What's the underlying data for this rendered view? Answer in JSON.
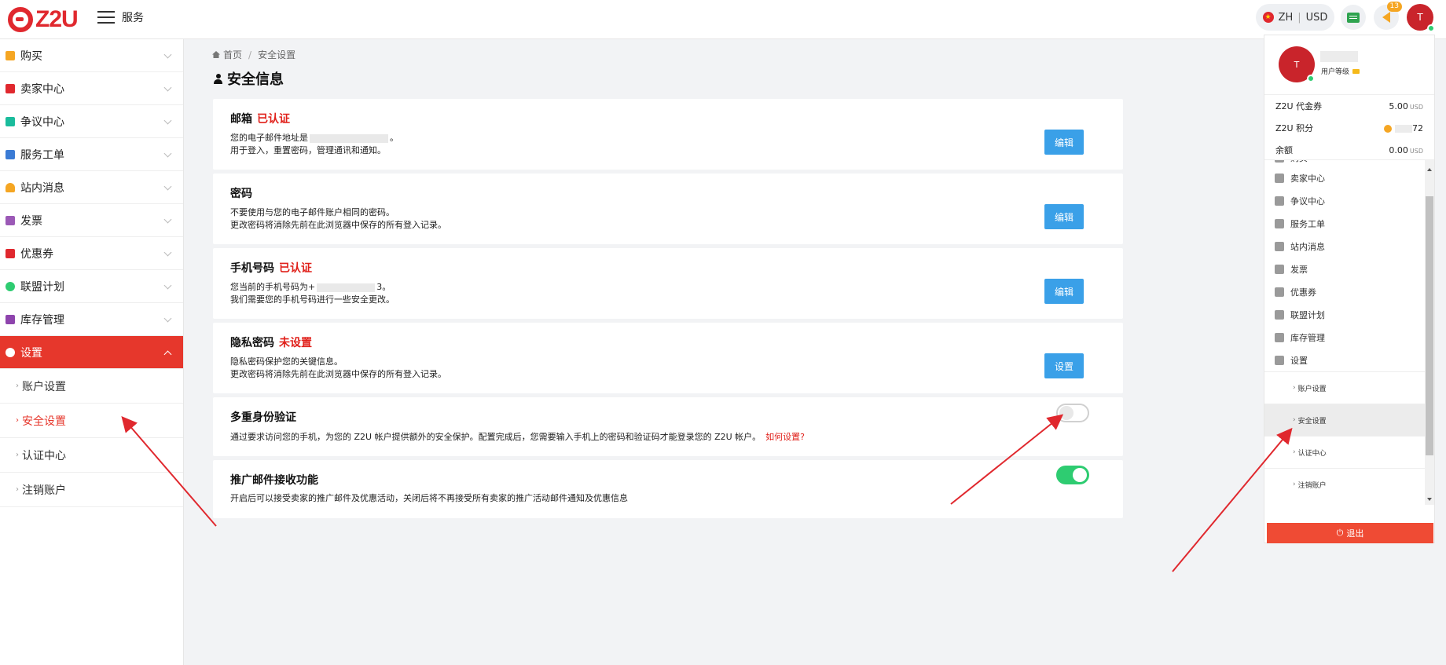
{
  "header": {
    "brand": "Z2U",
    "menu_label": "服务",
    "lang": "ZH",
    "currency": "USD",
    "notice_count": "13",
    "avatar_initial": "T"
  },
  "sidebar": {
    "items": [
      {
        "label": "购买",
        "icon_color": "#f5a623",
        "icon": "cart-icon"
      },
      {
        "label": "卖家中心",
        "icon_color": "#e0282e",
        "icon": "layers-icon"
      },
      {
        "label": "争议中心",
        "icon_color": "#1abc9c",
        "icon": "gavel-icon"
      },
      {
        "label": "服务工单",
        "icon_color": "#3a7bd5",
        "icon": "ticket-icon"
      },
      {
        "label": "站内消息",
        "icon_color": "#f5a623",
        "icon": "bell-icon"
      },
      {
        "label": "发票",
        "icon_color": "#9b59b6",
        "icon": "invoice-icon"
      },
      {
        "label": "优惠券",
        "icon_color": "#e0282e",
        "icon": "coupon-icon"
      },
      {
        "label": "联盟计划",
        "icon_color": "#2ecc71",
        "icon": "affiliate-icon"
      },
      {
        "label": "库存管理",
        "icon_color": "#8e44ad",
        "icon": "inventory-icon"
      },
      {
        "label": "设置",
        "icon_color": "#ffffff",
        "icon": "gear-icon"
      }
    ],
    "sub_items": [
      {
        "label": "账户设置"
      },
      {
        "label": "安全设置"
      },
      {
        "label": "认证中心"
      },
      {
        "label": "注销账户"
      }
    ]
  },
  "breadcrumb": {
    "home": "首页",
    "current": "安全设置"
  },
  "page_title": "安全信息",
  "cards": {
    "email": {
      "title": "邮箱",
      "status": "已认证",
      "line1_pre": "您的电子邮件地址是",
      "line1_post": "。",
      "line2": "用于登入，重置密码，管理通讯和通知。",
      "button": "编辑"
    },
    "password": {
      "title": "密码",
      "line1": "不要使用与您的电子邮件账户相同的密码。",
      "line2": "更改密码将消除先前在此浏览器中保存的所有登入记录。",
      "button": "编辑"
    },
    "phone": {
      "title": "手机号码",
      "status": "已认证",
      "line1_pre": "您当前的手机号码为+",
      "line1_post": "3。",
      "line2": "我们需要您的手机号码进行一些安全更改。",
      "button": "编辑"
    },
    "privacy": {
      "title": "隐私密码",
      "status": "未设置",
      "line1": "隐私密码保护您的关键信息。",
      "line2": "更改密码将消除先前在此浏览器中保存的所有登入记录。",
      "button": "设置"
    },
    "mfa": {
      "title": "多重身份验证",
      "line1": "通过要求访问您的手机，为您的 Z2U 帐户提供额外的安全保护。配置完成后，您需要输入手机上的密码和验证码才能登录您的 Z2U 帐户。",
      "link": "如何设置?",
      "enabled": false
    },
    "promo": {
      "title": "推广邮件接收功能",
      "line1": "开启后可以接受卖家的推广邮件及优惠活动，关闭后将不再接受所有卖家的推广活动邮件通知及优惠信息",
      "enabled": true
    }
  },
  "dropdown": {
    "avatar_initial": "T",
    "level_label": "用户等级",
    "rows": [
      {
        "label": "Z2U 代金券",
        "value": "5.00",
        "unit": "USD"
      },
      {
        "label": "Z2U 积分",
        "value": "72",
        "unit": ""
      },
      {
        "label": "余额",
        "value": "0.00",
        "unit": "USD"
      }
    ],
    "partial_item": "购买",
    "menu": [
      {
        "label": "卖家中心",
        "icon": "layers-icon"
      },
      {
        "label": "争议中心",
        "icon": "gavel-icon"
      },
      {
        "label": "服务工单",
        "icon": "ticket-icon"
      },
      {
        "label": "站内消息",
        "icon": "bell-icon"
      },
      {
        "label": "发票",
        "icon": "invoice-icon"
      },
      {
        "label": "优惠券",
        "icon": "coupon-icon"
      },
      {
        "label": "联盟计划",
        "icon": "affiliate-icon"
      },
      {
        "label": "库存管理",
        "icon": "inventory-icon"
      },
      {
        "label": "设置",
        "icon": "gear-icon"
      }
    ],
    "sub_menu": [
      {
        "label": "账户设置"
      },
      {
        "label": "安全设置"
      },
      {
        "label": "认证中心"
      },
      {
        "label": "注销账户"
      }
    ],
    "logout": "退出"
  },
  "colors": {
    "accent": "#e6372c",
    "button": "#3aa0e8",
    "toggle_on": "#2ecc71",
    "arrow": "#e0282e"
  }
}
